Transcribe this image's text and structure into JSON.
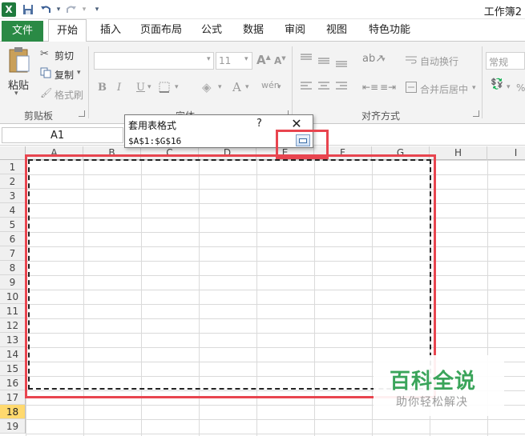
{
  "app": {
    "logo": "X",
    "title": "工作簿2"
  },
  "quick_access": {
    "save_icon": "save-icon",
    "undo_icon": "undo-icon",
    "redo_icon": "redo-icon"
  },
  "tabs": [
    {
      "label": "文件",
      "active": false
    },
    {
      "label": "开始",
      "active": true
    },
    {
      "label": "插入",
      "active": false
    },
    {
      "label": "页面布局",
      "active": false
    },
    {
      "label": "公式",
      "active": false
    },
    {
      "label": "数据",
      "active": false
    },
    {
      "label": "审阅",
      "active": false
    },
    {
      "label": "视图",
      "active": false
    },
    {
      "label": "特色功能",
      "active": false
    }
  ],
  "ribbon": {
    "clipboard": {
      "paste": "粘贴",
      "cut": "剪切",
      "copy": "复制",
      "format_painter": "格式刷",
      "group": "剪贴板"
    },
    "font": {
      "font_size": "11",
      "bold": "B",
      "italic": "I",
      "underline": "U",
      "group": "字体"
    },
    "alignment": {
      "wrap_text": "自动换行",
      "merge_center": "合并后居中",
      "group": "对齐方式"
    },
    "number": {
      "format": "常规",
      "percent": "%"
    }
  },
  "name_box": {
    "value": "A1"
  },
  "columns": [
    "A",
    "B",
    "C",
    "D",
    "E",
    "F",
    "G",
    "H",
    "I"
  ],
  "rows": [
    "1",
    "2",
    "3",
    "4",
    "5",
    "6",
    "7",
    "8",
    "9",
    "10",
    "11",
    "12",
    "13",
    "14",
    "15",
    "16",
    "17",
    "18",
    "19"
  ],
  "active_row": "18",
  "dialog": {
    "title": "套用表格式",
    "help": "?",
    "close": "✕",
    "range_value": "$A$1:$G$16"
  },
  "watermark": {
    "title": "百科全说",
    "subtitle": "助你轻松解决"
  },
  "colors": {
    "file_tab": "#2a8a45",
    "highlight": "#e8454f",
    "watermark_green": "#3aa45a",
    "active_row_header": "#ffd96e"
  }
}
